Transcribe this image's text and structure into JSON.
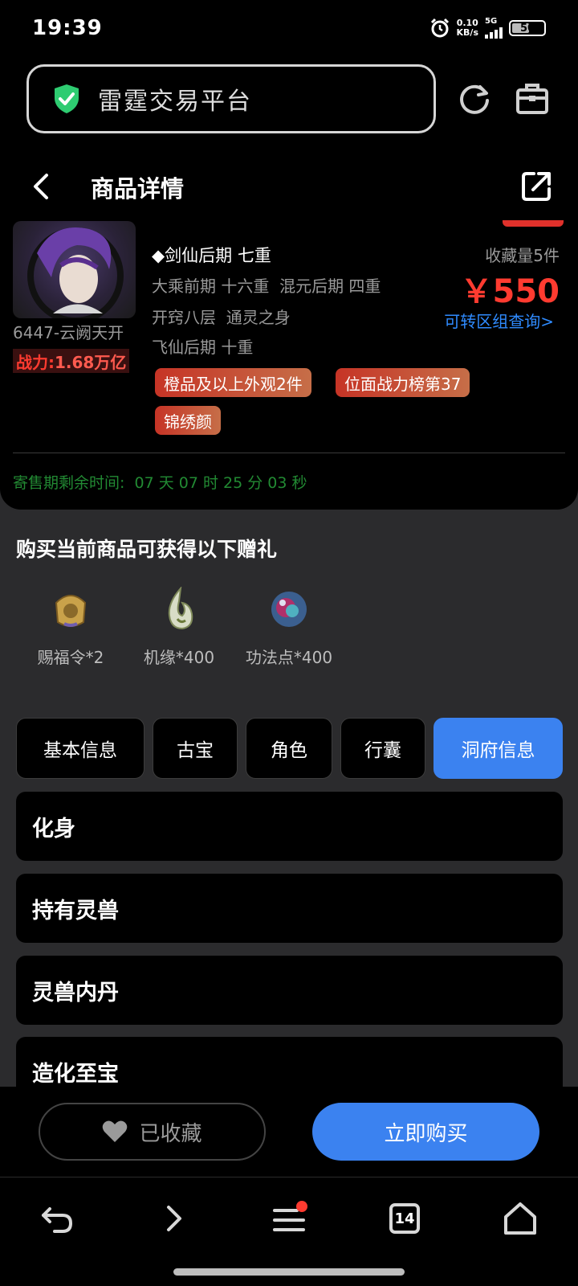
{
  "status_bar": {
    "time": "19:39",
    "net_speed_value": "0.10",
    "net_speed_unit": "KB/s",
    "signal_label": "5G",
    "battery": "50"
  },
  "address_bar": {
    "title": "雷霆交易平台"
  },
  "header": {
    "title": "商品详情"
  },
  "product": {
    "server_name": "6447-云阙天开",
    "power_label": "战力:",
    "power_value": "1.68万亿",
    "rank_lines": [
      "◆剑仙后期 七重",
      "大乘前期 十六重  混元后期 四重",
      "开窍八层  通灵之身",
      "飞仙后期 十重"
    ],
    "favorites": "收藏量5件",
    "price": "￥550",
    "cross_query": "可转区组查询>",
    "tags": [
      "橙品及以上外观2件",
      "位面战力榜第37",
      "锦绣颜"
    ],
    "countdown": "寄售期剩余时间:  07 天 07 时 25 分 03 秒"
  },
  "gifts": {
    "title": "购买当前商品可获得以下赠礼",
    "items": [
      {
        "label": "赐福令*2",
        "icon": "token-icon"
      },
      {
        "label": "机缘*400",
        "icon": "spirit-flame-icon"
      },
      {
        "label": "功法点*400",
        "icon": "orb-icon"
      }
    ]
  },
  "tabs": {
    "items": [
      "基本信息",
      "古宝",
      "角色",
      "行囊",
      "洞府信息"
    ],
    "active_index": 4
  },
  "sections": [
    "化身",
    "持有灵兽",
    "灵兽内丹",
    "造化至宝"
  ],
  "actions": {
    "favorite_label": "已收藏",
    "buy_label": "立即购买"
  },
  "browser_nav": {
    "tab_count": "14"
  },
  "colors": {
    "accent": "#3b82f0",
    "price_red": "#ff3b30",
    "countdown_green": "#228a33"
  }
}
